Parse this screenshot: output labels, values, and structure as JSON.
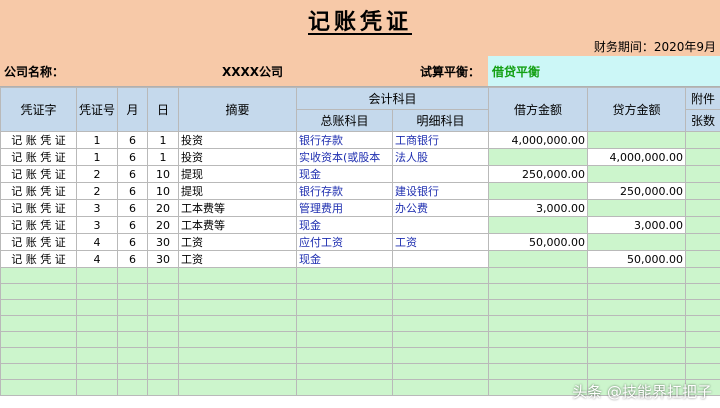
{
  "title": "记账凭证",
  "period": "财务期间：2020年9月",
  "company_label": "公司名称：",
  "company_name": "XXXX公司",
  "balance_label": "试算平衡：",
  "balance_value": "借贷平衡",
  "headers": {
    "voucher_type": "凭证字",
    "voucher_no": "凭证号",
    "month": "月",
    "day": "日",
    "summary": "摘要",
    "account_group": "会计科目",
    "general_account": "总账科目",
    "detail_account": "明细科目",
    "debit": "借方金额",
    "credit": "贷方金额",
    "attach1": "附件",
    "attach2": "张数"
  },
  "rows": [
    {
      "type": "记 账 凭 证",
      "no": "1",
      "month": "6",
      "day": "1",
      "summary": "投资",
      "general": "银行存款",
      "detail": "工商银行",
      "debit": "4,000,000.00",
      "credit": ""
    },
    {
      "type": "记 账 凭 证",
      "no": "1",
      "month": "6",
      "day": "1",
      "summary": "投资",
      "general": "实收资本(或股本",
      "detail": "法人股",
      "debit": "",
      "credit": "4,000,000.00"
    },
    {
      "type": "记 账 凭 证",
      "no": "2",
      "month": "6",
      "day": "10",
      "summary": "提现",
      "general": "现金",
      "detail": "",
      "debit": "250,000.00",
      "credit": ""
    },
    {
      "type": "记 账 凭 证",
      "no": "2",
      "month": "6",
      "day": "10",
      "summary": "提现",
      "general": "银行存款",
      "detail": "建设银行",
      "debit": "",
      "credit": "250,000.00"
    },
    {
      "type": "记 账 凭 证",
      "no": "3",
      "month": "6",
      "day": "20",
      "summary": "工本费等",
      "general": "管理费用",
      "detail": "办公费",
      "debit": "3,000.00",
      "credit": ""
    },
    {
      "type": "记 账 凭 证",
      "no": "3",
      "month": "6",
      "day": "20",
      "summary": "工本费等",
      "general": "现金",
      "detail": "",
      "debit": "",
      "credit": "3,000.00"
    },
    {
      "type": "记 账 凭 证",
      "no": "4",
      "month": "6",
      "day": "30",
      "summary": "工资",
      "general": "应付工资",
      "detail": "工资",
      "debit": "50,000.00",
      "credit": ""
    },
    {
      "type": "记 账 凭 证",
      "no": "4",
      "month": "6",
      "day": "30",
      "summary": "工资",
      "general": "现金",
      "detail": "",
      "debit": "",
      "credit": "50,000.00"
    }
  ],
  "watermark": "头条 @技能界扛把子"
}
